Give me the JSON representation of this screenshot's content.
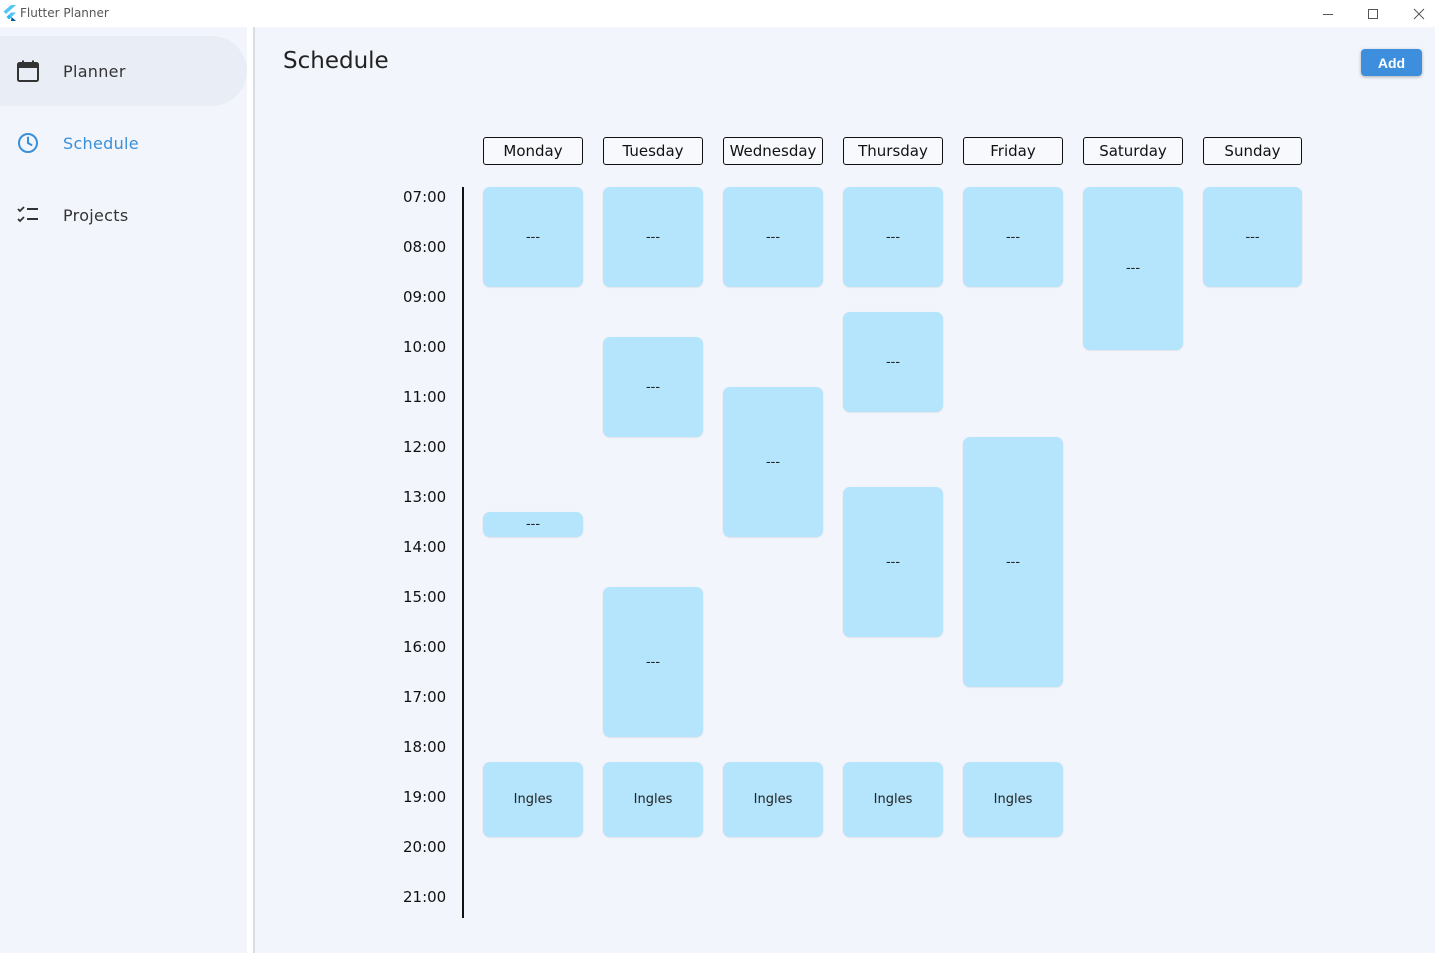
{
  "window": {
    "title": "Flutter Planner",
    "controls": [
      "minimize-icon",
      "maximize-icon",
      "close-icon"
    ]
  },
  "sidebar": {
    "items": [
      {
        "label": "Planner",
        "icon": "calendar-icon",
        "selected": false
      },
      {
        "label": "Schedule",
        "icon": "clock-icon",
        "selected": true
      },
      {
        "label": "Projects",
        "icon": "checklist-icon",
        "selected": false
      }
    ]
  },
  "header": {
    "title": "Schedule",
    "add_label": "Add"
  },
  "colors": {
    "accent": "#3a8fd9",
    "event_bg": "#b4e5fc",
    "background": "#f2f6fc"
  },
  "schedule": {
    "days": [
      "Monday",
      "Tuesday",
      "Wednesday",
      "Thursday",
      "Friday",
      "Saturday",
      "Sunday"
    ],
    "times": [
      "07:00",
      "08:00",
      "09:00",
      "10:00",
      "11:00",
      "12:00",
      "13:00",
      "14:00",
      "15:00",
      "16:00",
      "17:00",
      "18:00",
      "19:00",
      "20:00",
      "21:00"
    ],
    "events": [
      {
        "day": 0,
        "start": 7.0,
        "end": 9.0,
        "label": "---"
      },
      {
        "day": 0,
        "start": 13.5,
        "end": 14.0,
        "label": "---"
      },
      {
        "day": 0,
        "start": 18.5,
        "end": 20.0,
        "label": "Ingles"
      },
      {
        "day": 1,
        "start": 7.0,
        "end": 9.0,
        "label": "---"
      },
      {
        "day": 1,
        "start": 10.0,
        "end": 12.0,
        "label": "---"
      },
      {
        "day": 1,
        "start": 15.0,
        "end": 18.0,
        "label": "---"
      },
      {
        "day": 1,
        "start": 18.5,
        "end": 20.0,
        "label": "Ingles"
      },
      {
        "day": 2,
        "start": 7.0,
        "end": 9.0,
        "label": "---"
      },
      {
        "day": 2,
        "start": 11.0,
        "end": 14.0,
        "label": "---"
      },
      {
        "day": 2,
        "start": 18.5,
        "end": 20.0,
        "label": "Ingles"
      },
      {
        "day": 3,
        "start": 7.0,
        "end": 9.0,
        "label": "---"
      },
      {
        "day": 3,
        "start": 9.5,
        "end": 11.5,
        "label": "---"
      },
      {
        "day": 3,
        "start": 13.0,
        "end": 16.0,
        "label": "---"
      },
      {
        "day": 3,
        "start": 18.5,
        "end": 20.0,
        "label": "Ingles"
      },
      {
        "day": 4,
        "start": 7.0,
        "end": 9.0,
        "label": "---"
      },
      {
        "day": 4,
        "start": 12.0,
        "end": 17.0,
        "label": "---"
      },
      {
        "day": 4,
        "start": 18.5,
        "end": 20.0,
        "label": "Ingles"
      },
      {
        "day": 5,
        "start": 7.0,
        "end": 10.25,
        "label": "---"
      },
      {
        "day": 6,
        "start": 7.0,
        "end": 9.0,
        "label": "---"
      }
    ]
  }
}
